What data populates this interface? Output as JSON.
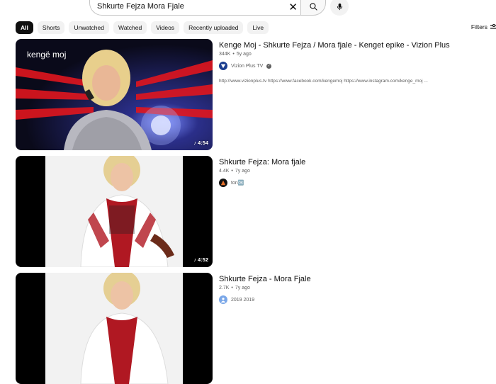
{
  "search": {
    "query": "Shkurte Fejza Mora Fjale"
  },
  "chips": [
    "All",
    "Shorts",
    "Unwatched",
    "Watched",
    "Videos",
    "Recently uploaded",
    "Live"
  ],
  "filters_label": "Filters",
  "results": [
    {
      "title": "Kenge Moj - Shkurte Fejza / Mora fjale - Kenget epike - Vizion Plus",
      "views": "344K",
      "age": "5y ago",
      "channel": "Vizion Plus TV",
      "verified": true,
      "description": "http://www.vizionplus.tv https://www.facebook.com/kengemoj https://www.instagram.com/kenge_moj ...",
      "duration": "4:54",
      "thumb_logo": "kengë moj"
    },
    {
      "title": "Shkurte Fejza: Mora fjale",
      "views": "4.4K",
      "age": "7y ago",
      "channel": "ton🆗",
      "duration": "4:52"
    },
    {
      "title": "Shkurte Fejza - Mora Fjale",
      "views": "2.7K",
      "age": "7y ago",
      "channel": "2019 2019"
    }
  ],
  "colors": {
    "chip_active": "#0f0f0f",
    "chip_bg": "#f2f2f2",
    "meta_text": "#606060",
    "channel_avatar_1": "#1a3d8f"
  }
}
